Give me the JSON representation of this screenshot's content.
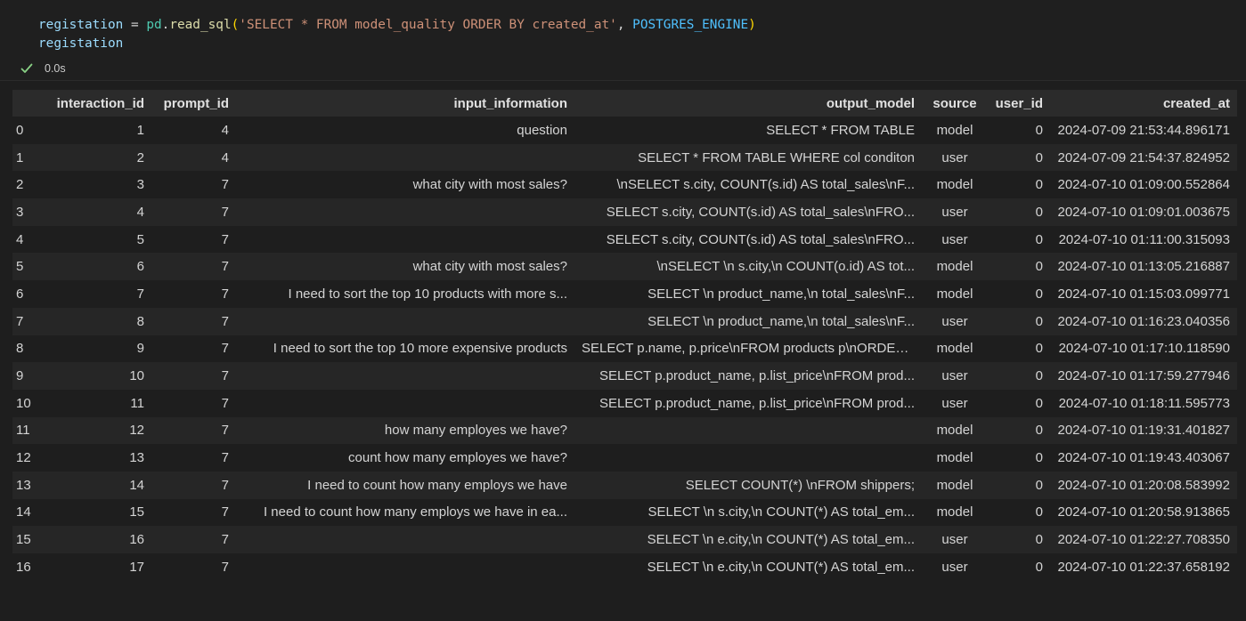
{
  "code": {
    "line1": {
      "var": "registation",
      "op": " = ",
      "mod": "pd",
      "dot": ".",
      "fn": "read_sql",
      "open": "(",
      "str": "'SELECT * FROM model_quality ORDER BY created_at'",
      "comma": ", ",
      "const": "POSTGRES_ENGINE",
      "close": ")"
    },
    "line2": "registation"
  },
  "status": {
    "icon": "check-icon",
    "duration": "0.0s",
    "color": "#89d185"
  },
  "table": {
    "columns": [
      "",
      "interaction_id",
      "prompt_id",
      "input_information",
      "output_model",
      "source",
      "user_id",
      "created_at"
    ],
    "rows": [
      [
        "0",
        "1",
        "4",
        "question",
        "SELECT * FROM TABLE",
        "model",
        "0",
        "2024-07-09 21:53:44.896171"
      ],
      [
        "1",
        "2",
        "4",
        "",
        "SELECT * FROM TABLE WHERE col conditon",
        "user",
        "0",
        "2024-07-09 21:54:37.824952"
      ],
      [
        "2",
        "3",
        "7",
        "what city with most sales?",
        "\\nSELECT s.city, COUNT(s.id) AS total_sales\\nF...",
        "model",
        "0",
        "2024-07-10 01:09:00.552864"
      ],
      [
        "3",
        "4",
        "7",
        "",
        "SELECT s.city, COUNT(s.id) AS total_sales\\nFRO...",
        "user",
        "0",
        "2024-07-10 01:09:01.003675"
      ],
      [
        "4",
        "5",
        "7",
        "",
        "SELECT s.city, COUNT(s.id) AS total_sales\\nFRO...",
        "user",
        "0",
        "2024-07-10 01:11:00.315093"
      ],
      [
        "5",
        "6",
        "7",
        "what city with most sales?",
        "\\nSELECT \\n s.city,\\n COUNT(o.id) AS tot...",
        "model",
        "0",
        "2024-07-10 01:13:05.216887"
      ],
      [
        "6",
        "7",
        "7",
        "I need to sort the top 10 products with more s...",
        "SELECT \\n product_name,\\n total_sales\\nF...",
        "model",
        "0",
        "2024-07-10 01:15:03.099771"
      ],
      [
        "7",
        "8",
        "7",
        "",
        "SELECT \\n product_name,\\n total_sales\\nF...",
        "user",
        "0",
        "2024-07-10 01:16:23.040356"
      ],
      [
        "8",
        "9",
        "7",
        "I need to sort the top 10 more expensive products",
        "SELECT p.name, p.price\\nFROM products p\\nORDER...",
        "model",
        "0",
        "2024-07-10 01:17:10.118590"
      ],
      [
        "9",
        "10",
        "7",
        "",
        "SELECT p.product_name, p.list_price\\nFROM prod...",
        "user",
        "0",
        "2024-07-10 01:17:59.277946"
      ],
      [
        "10",
        "11",
        "7",
        "",
        "SELECT p.product_name, p.list_price\\nFROM prod...",
        "user",
        "0",
        "2024-07-10 01:18:11.595773"
      ],
      [
        "11",
        "12",
        "7",
        "how many employes we have?",
        "",
        "model",
        "0",
        "2024-07-10 01:19:31.401827"
      ],
      [
        "12",
        "13",
        "7",
        "count how many employes we have?",
        "",
        "model",
        "0",
        "2024-07-10 01:19:43.403067"
      ],
      [
        "13",
        "14",
        "7",
        "I need to count how many employs we have",
        "SELECT COUNT(*) \\nFROM shippers;",
        "model",
        "0",
        "2024-07-10 01:20:08.583992"
      ],
      [
        "14",
        "15",
        "7",
        "I need to count how many employs we have in ea...",
        "SELECT \\n s.city,\\n COUNT(*) AS total_em...",
        "model",
        "0",
        "2024-07-10 01:20:58.913865"
      ],
      [
        "15",
        "16",
        "7",
        "",
        "SELECT \\n e.city,\\n COUNT(*) AS total_em...",
        "user",
        "0",
        "2024-07-10 01:22:27.708350"
      ],
      [
        "16",
        "17",
        "7",
        "",
        "SELECT \\n e.city,\\n COUNT(*) AS total_em...",
        "user",
        "0",
        "2024-07-10 01:22:37.658192"
      ]
    ]
  }
}
